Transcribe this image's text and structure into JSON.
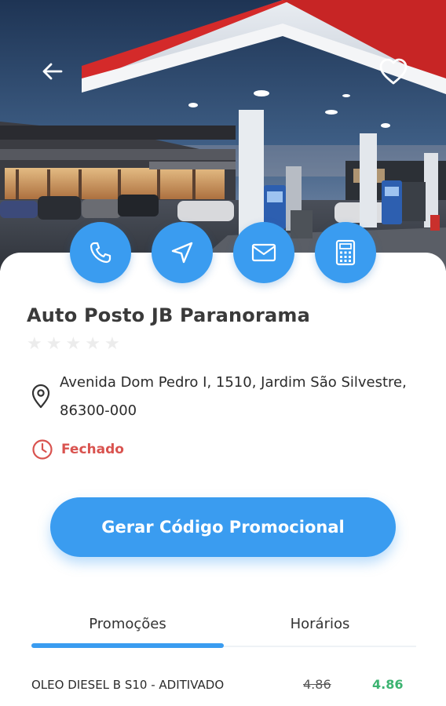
{
  "header": {
    "back_icon": "arrow-left-icon",
    "favorite_icon": "heart-outline-icon"
  },
  "actions": [
    {
      "icon": "phone-icon"
    },
    {
      "icon": "navigation-arrow-icon"
    },
    {
      "icon": "mail-icon"
    },
    {
      "icon": "calculator-icon"
    }
  ],
  "station": {
    "name": "Auto Posto JB Paranorama",
    "rating": 0,
    "rating_max": 5,
    "address": "Avenida Dom Pedro I, 1510, Jardim São Silvestre, 86300-000",
    "status": "Fechado"
  },
  "promo_button_label": "Gerar Código Promocional",
  "tabs": [
    {
      "label": "Promoções",
      "active": true
    },
    {
      "label": "Horários",
      "active": false
    }
  ],
  "products": [
    {
      "name": "OLEO DIESEL B S10 - ADITIVADO",
      "old_price": "4.86",
      "new_price": "4.86"
    }
  ],
  "colors": {
    "accent": "#3a9cf0",
    "closed": "#d9534f",
    "price_new": "#3cb371"
  }
}
